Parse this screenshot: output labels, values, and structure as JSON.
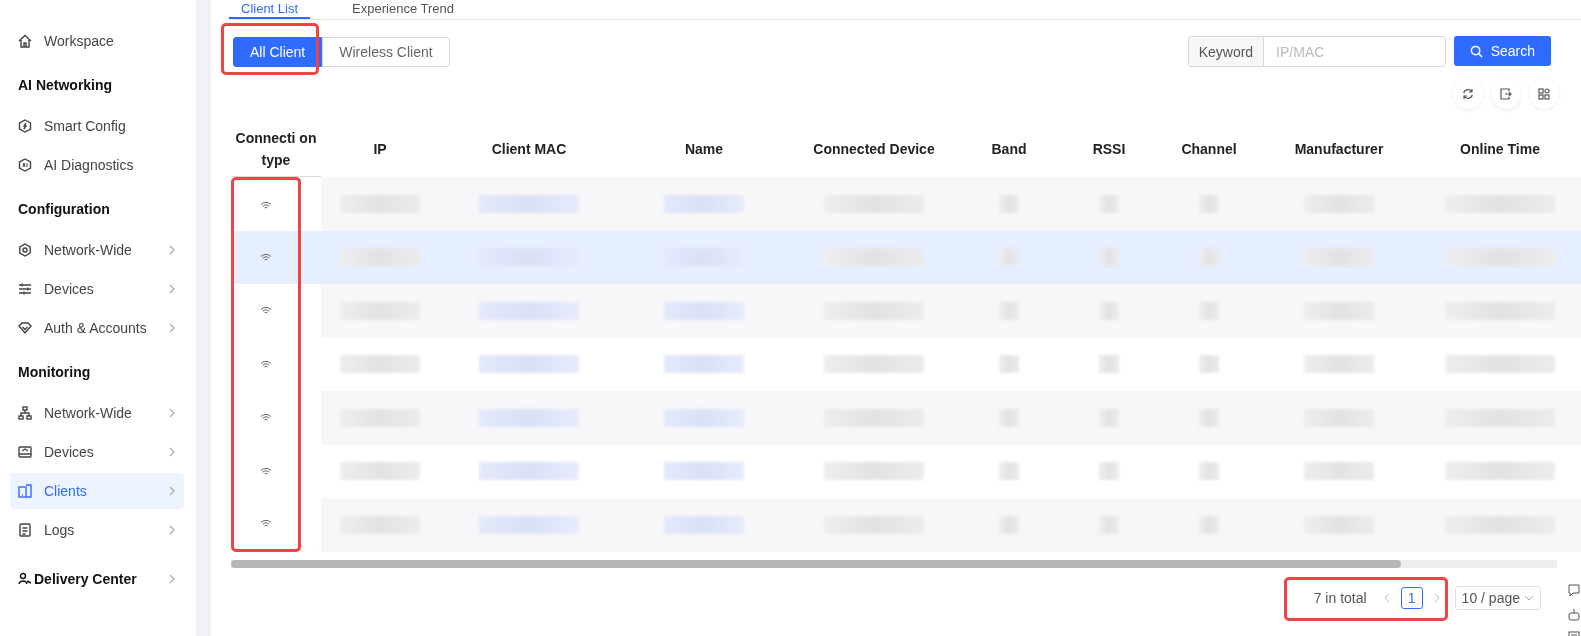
{
  "sidebar": {
    "sections": [
      {
        "items": [
          {
            "label": "Workspace",
            "expandable": false,
            "selected": false
          }
        ]
      },
      {
        "title": "AI Networking",
        "items": [
          {
            "label": "Smart Config",
            "expandable": false,
            "selected": false
          },
          {
            "label": "AI Diagnostics",
            "expandable": false,
            "selected": false
          }
        ]
      },
      {
        "title": "Configuration",
        "items": [
          {
            "label": "Network-Wide",
            "expandable": true,
            "selected": false
          },
          {
            "label": "Devices",
            "expandable": true,
            "selected": false
          },
          {
            "label": "Auth & Accounts",
            "expandable": true,
            "selected": false
          }
        ]
      },
      {
        "title": "Monitoring",
        "items": [
          {
            "label": "Network-Wide",
            "expandable": true,
            "selected": false
          },
          {
            "label": "Devices",
            "expandable": true,
            "selected": false
          },
          {
            "label": "Clients",
            "expandable": true,
            "selected": true
          },
          {
            "label": "Logs",
            "expandable": true,
            "selected": false
          }
        ]
      }
    ],
    "footer": {
      "label": "Delivery Center",
      "expandable": true
    }
  },
  "tabs": [
    {
      "label": "Client List",
      "selected": true
    },
    {
      "label": "Experience Trend",
      "selected": false
    }
  ],
  "filter": {
    "highlighted": true,
    "options": [
      {
        "label": "All Client",
        "selected": true
      },
      {
        "label": "Wireless Client",
        "selected": false
      }
    ]
  },
  "search": {
    "addon": "Keyword",
    "placeholder": "IP/MAC",
    "button": "Search"
  },
  "table": {
    "columns": [
      "Connecti on type",
      "IP",
      "Client MAC",
      "Name",
      "Connected Device",
      "Band",
      "RSSI",
      "Channel",
      "Manufacturer",
      "Online Time"
    ],
    "connection_column_highlighted": true,
    "rows": [
      {
        "kind": "wireless",
        "selected": false
      },
      {
        "kind": "wireless",
        "selected": true
      },
      {
        "kind": "wireless",
        "selected": false
      },
      {
        "kind": "wireless",
        "selected": false
      },
      {
        "kind": "wireless",
        "selected": false
      },
      {
        "kind": "wireless",
        "selected": false
      },
      {
        "kind": "wireless",
        "selected": false
      }
    ]
  },
  "pagination": {
    "highlighted": true,
    "total": "7 in total",
    "pages": [
      {
        "label": "1",
        "selected": true
      }
    ],
    "page_size": "10 / page"
  }
}
